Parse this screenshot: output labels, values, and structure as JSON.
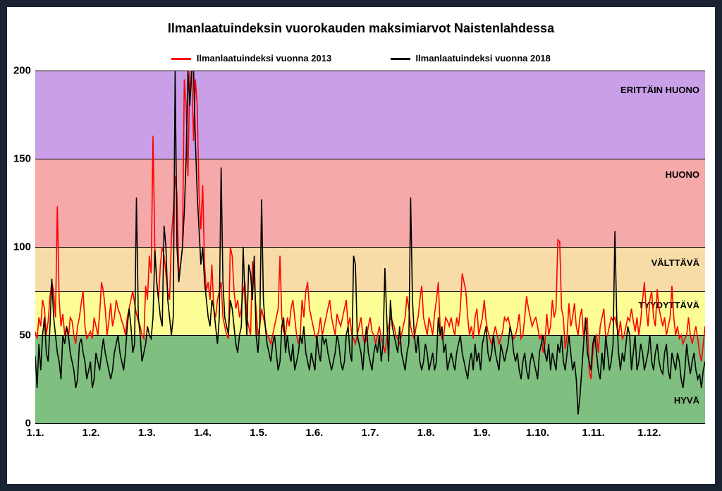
{
  "chart_data": {
    "type": "line",
    "title": "Ilmanlaatuindeksin vuorokauden maksimiarvot Naistenlahdessa",
    "xlabel": "",
    "ylabel": "",
    "ylim": [
      0,
      200
    ],
    "y_ticks": [
      0,
      50,
      100,
      150,
      200
    ],
    "categories": [
      "1.1.",
      "1.2.",
      "1.3.",
      "1.4.",
      "1.5.",
      "1.6.",
      "1.7.",
      "1.8.",
      "1.9.",
      "1.10.",
      "1.11.",
      "1.12."
    ],
    "bands": [
      {
        "name": "ERITTÄIN HUONO",
        "from": 150,
        "to": 200,
        "color": "#c9a0e8"
      },
      {
        "name": "HUONO",
        "from": 100,
        "to": 150,
        "color": "#f5a9a9"
      },
      {
        "name": "VÄLTTÄVÄ",
        "from": 75,
        "to": 100,
        "color": "#f7dca8"
      },
      {
        "name": "TYYDYTTÄVÄ",
        "from": 50,
        "to": 75,
        "color": "#fdfd96"
      },
      {
        "name": "HYVÄ",
        "from": 0,
        "to": 50,
        "color": "#7fbf7f"
      }
    ],
    "band_labels": {
      "erittain_huono": "ERITTÄIN HUONO",
      "huono": "HUONO",
      "valttava": "VÄLTTÄVÄ",
      "tyydyttava": "TYYDYTTÄVÄ",
      "hyva": "HYVÄ"
    },
    "series": [
      {
        "name": "Ilmanlaatuindeksi vuonna 2013",
        "color": "#ff0000",
        "values": [
          52,
          48,
          60,
          55,
          70,
          65,
          50,
          58,
          72,
          80,
          75,
          60,
          123,
          70,
          55,
          62,
          50,
          55,
          48,
          60,
          58,
          50,
          45,
          55,
          60,
          68,
          75,
          55,
          48,
          50,
          52,
          48,
          60,
          55,
          50,
          62,
          80,
          75,
          65,
          50,
          58,
          68,
          55,
          60,
          70,
          65,
          62,
          58,
          55,
          50,
          60,
          65,
          70,
          75,
          68,
          62,
          58,
          55,
          50,
          48,
          78,
          70,
          95,
          85,
          163,
          100,
          80,
          70,
          90,
          100,
          95,
          85,
          75,
          70,
          105,
          120,
          140,
          130,
          85,
          90,
          100,
          195,
          180,
          140,
          200,
          200,
          160,
          195,
          180,
          130,
          110,
          135,
          90,
          75,
          80,
          70,
          90,
          65,
          60,
          70,
          75,
          80,
          60,
          55,
          50,
          48,
          100,
          95,
          75,
          65,
          70,
          60,
          65,
          75,
          80,
          60,
          55,
          50,
          92,
          80,
          65,
          50,
          55,
          65,
          60,
          55,
          50,
          48,
          45,
          50,
          55,
          60,
          65,
          95,
          60,
          52,
          50,
          60,
          55,
          65,
          70,
          60,
          50,
          45,
          50,
          70,
          60,
          75,
          80,
          65,
          60,
          55,
          50,
          48,
          52,
          60,
          50,
          55,
          60,
          65,
          70,
          60,
          55,
          50,
          62,
          58,
          55,
          60,
          65,
          70,
          55,
          60,
          50,
          48,
          45,
          50,
          55,
          60,
          50,
          45,
          48,
          55,
          60,
          52,
          50,
          45,
          50,
          55,
          48,
          45,
          40,
          48,
          55,
          60,
          58,
          55,
          50,
          48,
          45,
          50,
          55,
          60,
          72,
          65,
          55,
          50,
          48,
          55,
          60,
          70,
          78,
          60,
          55,
          50,
          60,
          55,
          50,
          62,
          70,
          80,
          55,
          48,
          50,
          60,
          58,
          55,
          60,
          54,
          50,
          60,
          55,
          65,
          85,
          80,
          75,
          60,
          50,
          55,
          48,
          60,
          65,
          50,
          55,
          60,
          70,
          58,
          52,
          48,
          45,
          50,
          55,
          50,
          45,
          48,
          52,
          60,
          58,
          60,
          55,
          50,
          48,
          50,
          55,
          62,
          48,
          50,
          60,
          72,
          65,
          60,
          55,
          58,
          60,
          55,
          48,
          50,
          40,
          45,
          62,
          50,
          55,
          70,
          60,
          65,
          104,
          103,
          65,
          60,
          42,
          50,
          68,
          55,
          60,
          68,
          55,
          50,
          60,
          65,
          48,
          55,
          60,
          30,
          25,
          40,
          48,
          50,
          40,
          55,
          60,
          65,
          48,
          50,
          55,
          60,
          58,
          60,
          55,
          50,
          58,
          48,
          50,
          55,
          60,
          58,
          65,
          58,
          52,
          60,
          50,
          58,
          70,
          80,
          65,
          55,
          70,
          75,
          60,
          55,
          76,
          65,
          60,
          55,
          60,
          50,
          55,
          60,
          78,
          60,
          50,
          55,
          48,
          50,
          45,
          48,
          50,
          60,
          50,
          45,
          50,
          55,
          48,
          40,
          35,
          45,
          55
        ]
      },
      {
        "name": "Ilmanlaatuindeksi vuonna 2018",
        "color": "#000000",
        "values": [
          38,
          20,
          45,
          30,
          50,
          60,
          40,
          35,
          55,
          82,
          60,
          50,
          40,
          35,
          25,
          50,
          45,
          55,
          50,
          40,
          35,
          30,
          20,
          25,
          45,
          48,
          40,
          35,
          25,
          30,
          35,
          20,
          25,
          40,
          35,
          30,
          40,
          48,
          40,
          35,
          30,
          25,
          30,
          40,
          45,
          50,
          40,
          35,
          30,
          40,
          55,
          65,
          55,
          40,
          45,
          128,
          60,
          50,
          35,
          40,
          45,
          55,
          50,
          48,
          60,
          98,
          80,
          70,
          60,
          55,
          112,
          100,
          70,
          60,
          50,
          60,
          200,
          100,
          80,
          90,
          100,
          120,
          150,
          200,
          180,
          200,
          200,
          160,
          130,
          110,
          90,
          100,
          80,
          70,
          60,
          55,
          70,
          65,
          55,
          45,
          60,
          145,
          80,
          60,
          55,
          50,
          70,
          65,
          55,
          45,
          40,
          50,
          55,
          100,
          70,
          50,
          90,
          85,
          70,
          95,
          50,
          40,
          55,
          127,
          70,
          55,
          45,
          40,
          35,
          45,
          50,
          40,
          30,
          35,
          55,
          60,
          40,
          50,
          40,
          35,
          45,
          30,
          35,
          40,
          50,
          45,
          55,
          40,
          35,
          30,
          40,
          35,
          30,
          50,
          40,
          35,
          50,
          45,
          48,
          40,
          35,
          30,
          35,
          40,
          50,
          45,
          35,
          30,
          35,
          50,
          55,
          40,
          35,
          95,
          90,
          50,
          45,
          40,
          30,
          45,
          55,
          40,
          35,
          30,
          40,
          45,
          40,
          50,
          35,
          45,
          88,
          60,
          35,
          70,
          55,
          50,
          45,
          40,
          55,
          40,
          35,
          30,
          40,
          45,
          128,
          70,
          50,
          40,
          50,
          35,
          30,
          35,
          45,
          40,
          30,
          35,
          40,
          30,
          35,
          60,
          50,
          55,
          40,
          45,
          30,
          35,
          40,
          35,
          30,
          40,
          45,
          50,
          40,
          35,
          30,
          25,
          35,
          40,
          30,
          45,
          35,
          40,
          30,
          45,
          50,
          55,
          40,
          35,
          40,
          50,
          40,
          35,
          30,
          45,
          40,
          35,
          40,
          45,
          55,
          50,
          40,
          35,
          40,
          30,
          25,
          35,
          40,
          30,
          25,
          35,
          40,
          35,
          30,
          25,
          40,
          45,
          50,
          40,
          35,
          45,
          30,
          40,
          35,
          30,
          45,
          40,
          50,
          35,
          30,
          40,
          50,
          40,
          30,
          35,
          25,
          5,
          15,
          30,
          45,
          60,
          40,
          35,
          30,
          45,
          50,
          40,
          30,
          25,
          40,
          30,
          50,
          40,
          30,
          35,
          45,
          109,
          60,
          40,
          30,
          40,
          35,
          45,
          55,
          50,
          30,
          40,
          50,
          30,
          35,
          45,
          40,
          30,
          35,
          40,
          50,
          35,
          30,
          40,
          45,
          35,
          30,
          28,
          40,
          45,
          30,
          25,
          40,
          35,
          30,
          40,
          35,
          25,
          20,
          30,
          45,
          35,
          28,
          35,
          40,
          30,
          25,
          28,
          20,
          30,
          35
        ]
      }
    ],
    "legend_labels": {
      "s2013": "Ilmanlaatuindeksi vuonna 2013",
      "s2018": "Ilmanlaatuindeksi vuonna 2018"
    }
  }
}
